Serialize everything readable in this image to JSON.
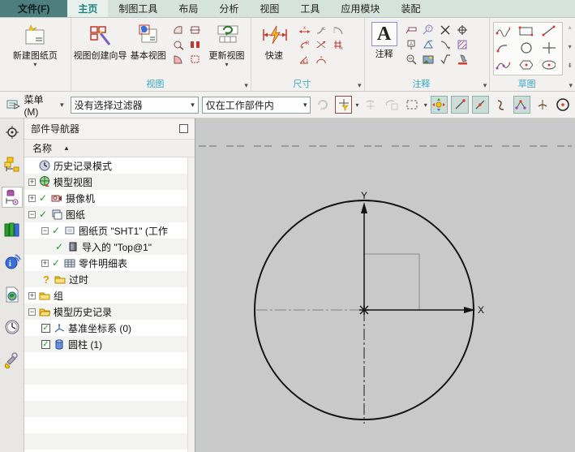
{
  "menu": {
    "file": "文件(F)",
    "tabs": [
      {
        "label": "主页"
      },
      {
        "label": "制图工具"
      },
      {
        "label": "布局"
      },
      {
        "label": "分析"
      },
      {
        "label": "视图"
      },
      {
        "label": "工具"
      },
      {
        "label": "应用模块"
      },
      {
        "label": "装配"
      }
    ]
  },
  "ribbon": {
    "new_sheet": "新建图纸页",
    "view_wizard": "视图创建向导",
    "base_view": "基本视图",
    "update_view": "更新视图",
    "rapid": "快速",
    "note": "注释",
    "note_letter": "A",
    "groups": {
      "view": "视图",
      "dimension": "尺寸",
      "annotation": "注释",
      "sketch": "草图"
    }
  },
  "toolbar": {
    "menu": "菜单(M)",
    "filter": "没有选择过滤器",
    "scope": "仅在工作部件内"
  },
  "navigator": {
    "title": "部件导航器",
    "column": "名称",
    "items": [
      {
        "label": "历史记录模式"
      },
      {
        "label": "模型视图",
        "expander": "+"
      },
      {
        "label": "摄像机",
        "expander": "+",
        "check": "✓"
      },
      {
        "label": "图纸",
        "expander": "−",
        "check": "✓"
      },
      {
        "label": "图纸页 \"SHT1\" (工作",
        "expander": "−",
        "check": "✓"
      },
      {
        "label": "导入的 \"Top@1\"",
        "check": "✓"
      },
      {
        "label": "零件明细表",
        "expander": "+",
        "check": "✓"
      },
      {
        "label": "过时",
        "check": "?"
      },
      {
        "label": "组",
        "expander": "+"
      },
      {
        "label": "模型历史记录",
        "expander": "−"
      },
      {
        "label": "基准坐标系 (0)",
        "check": "✓"
      },
      {
        "label": "圆柱 (1)",
        "check": "✓"
      }
    ]
  },
  "canvas": {
    "x_label": "X",
    "y_label": "Y"
  },
  "glyphs": {
    "caret": "▾",
    "sort_asc": "▲",
    "up": "▴",
    "down": "▾",
    "dbl_down": "⇟"
  },
  "colors": {
    "accent_teal": "#4e7f7f",
    "section_label": "#3aa6c4",
    "canvas_bg": "#c9c9c9",
    "check_green": "#1f9c1f",
    "pressed_bg": "#ccdcd7"
  }
}
